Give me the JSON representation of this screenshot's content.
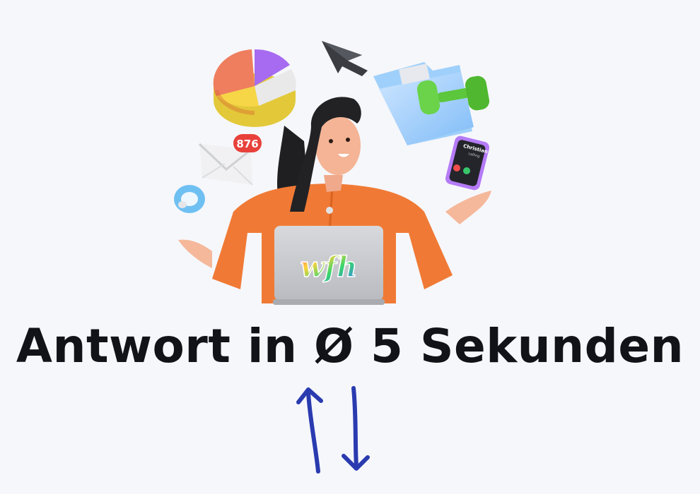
{
  "hero": {
    "headline": "Antwort in Ø 5 Sekunden",
    "notification_badge": "876",
    "phone": {
      "caller_name": "Christian",
      "caller_status": "calling"
    },
    "laptop_sticker_text": "wfh",
    "icons": [
      "pie-chart-icon",
      "cursor-icon",
      "folder-icon",
      "dumbbell-icon",
      "envelope-icon",
      "pacifier-icon",
      "smartphone-icon",
      "laptop-icon",
      "swap-arrows-icon"
    ]
  },
  "colors": {
    "background": "#f6f7fb",
    "headline": "#121318",
    "arrows": "#2a3bb0",
    "sweater": "#f07a35",
    "badge": "#e8413b"
  }
}
